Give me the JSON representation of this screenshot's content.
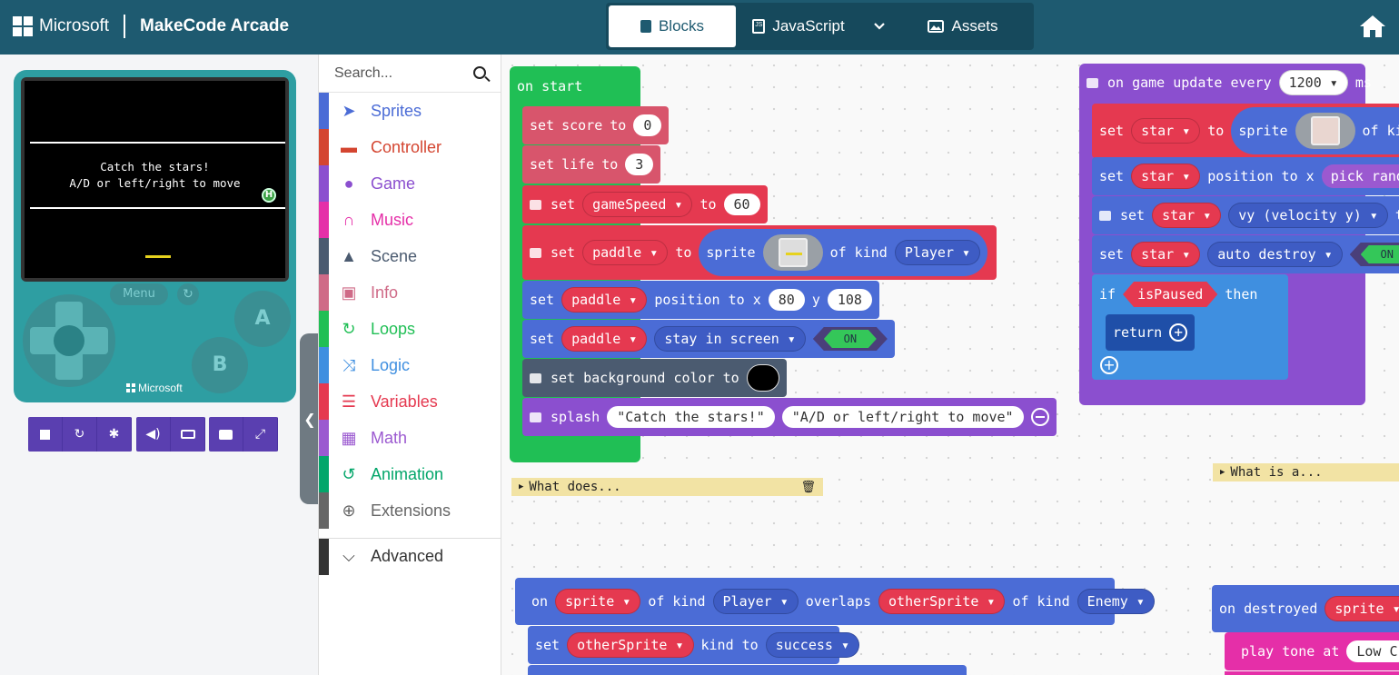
{
  "header": {
    "brand": "Microsoft",
    "app_name": "MakeCode Arcade",
    "tabs": [
      {
        "label": "Blocks",
        "icon": "puzzle-icon",
        "active": true
      },
      {
        "label": "JavaScript",
        "icon": "js-file-icon"
      },
      {
        "label": "",
        "icon": "chevron-down-icon"
      },
      {
        "label": "Assets",
        "icon": "image-icon"
      }
    ],
    "home_icon": "home-icon"
  },
  "simulator": {
    "screen_line1": "Catch the stars!",
    "screen_line2": "A/D or left/right to move",
    "badge": "H",
    "menu_label": "Menu",
    "button_a": "A",
    "button_b": "B",
    "console_brand": "Microsoft",
    "toolbar_icons": [
      "stop-icon",
      "restart-icon",
      "debug-bug-icon",
      "sound-icon",
      "keyboard-icon",
      "screenshot-icon",
      "fullscreen-icon"
    ]
  },
  "toolbox": {
    "search_placeholder": "Search...",
    "categories": [
      {
        "label": "Sprites",
        "color": "#4b6cd6",
        "icon": "paper-plane-icon"
      },
      {
        "label": "Controller",
        "color": "#d44530",
        "icon": "gamepad-icon"
      },
      {
        "label": "Game",
        "color": "#8b4fcf",
        "icon": "circle-icon"
      },
      {
        "label": "Music",
        "color": "#e52fa8",
        "icon": "headphones-icon"
      },
      {
        "label": "Scene",
        "color": "#4b5b70",
        "icon": "tree-icon"
      },
      {
        "label": "Info",
        "color": "#cf6a87",
        "icon": "id-card-icon"
      },
      {
        "label": "Loops",
        "color": "#20bf55",
        "icon": "loop-icon"
      },
      {
        "label": "Logic",
        "color": "#3f8fe0",
        "icon": "shuffle-icon"
      },
      {
        "label": "Variables",
        "color": "#e53950",
        "icon": "list-icon"
      },
      {
        "label": "Math",
        "color": "#9b59d0",
        "icon": "calculator-icon"
      },
      {
        "label": "Animation",
        "color": "#03a66a",
        "icon": "refresh-icon"
      },
      {
        "label": "Extensions",
        "color": "#666666",
        "icon": "plus-circle-icon"
      }
    ],
    "advanced": "Advanced"
  },
  "workspace": {
    "on_start": {
      "hat": "on start",
      "set_score": {
        "set": "set",
        "var": "score",
        "to": "to",
        "value": "0"
      },
      "set_life": {
        "set": "set",
        "var": "life",
        "to": "to",
        "value": "3"
      },
      "set_speed": {
        "set": "set",
        "var": "gameSpeed",
        "to": "to",
        "value": "60"
      },
      "set_paddle": {
        "set": "set",
        "var": "paddle",
        "to": "to",
        "sprite": "sprite",
        "of_kind": "of kind",
        "kind": "Player"
      },
      "paddle_pos": {
        "set": "set",
        "var": "paddle",
        "position": "position to x",
        "x": "80",
        "y_label": "y",
        "y": "108"
      },
      "paddle_stay": {
        "set": "set",
        "var": "paddle",
        "prop": "stay in screen",
        "toggle": "ON"
      },
      "bg_color": "set background color to",
      "splash": {
        "label": "splash",
        "text1": "\"Catch the stars!\"",
        "text2": "\"A/D or left/right to move\""
      }
    },
    "comment1": "What does...",
    "comment2": "What is a...",
    "game_update": {
      "hat": "on game update every",
      "interval": "1200",
      "unit": "ms",
      "set_star": {
        "set": "set",
        "var": "star",
        "to": "to",
        "sprite": "sprite",
        "of_kind": "of kin"
      },
      "star_pos": {
        "set": "set",
        "var": "star",
        "position": "position to x",
        "pick": "pick rando"
      },
      "star_vy": {
        "set": "set",
        "var": "star",
        "prop": "vy (velocity y)",
        "to": "to"
      },
      "star_auto": {
        "set": "set",
        "var": "star",
        "prop": "auto destroy",
        "toggle": "ON"
      },
      "if": {
        "if": "if",
        "cond": "isPaused",
        "then": "then"
      },
      "return": "return"
    },
    "overlap": {
      "on": "on",
      "sprite": "sprite",
      "of_kind": "of kind",
      "kind1": "Player",
      "overlaps": "overlaps",
      "other": "otherSprite",
      "of_kind2": "of kind",
      "kind2": "Enemy",
      "set": "set",
      "var": "otherSprite",
      "kind_to": "kind to",
      "new_kind": "success"
    },
    "destroyed": {
      "hat": "on destroyed",
      "sprite": "sprite",
      "tail": "o",
      "play_tone": "play tone at",
      "note": "Low C"
    }
  },
  "colors": {
    "header": "#1e5a70",
    "variables": "#e53950",
    "sprites": "#4b6cd6",
    "loops": "#20bf55",
    "game": "#8b4fcf",
    "scene": "#4b5b70",
    "logic": "#3f8fe0"
  }
}
